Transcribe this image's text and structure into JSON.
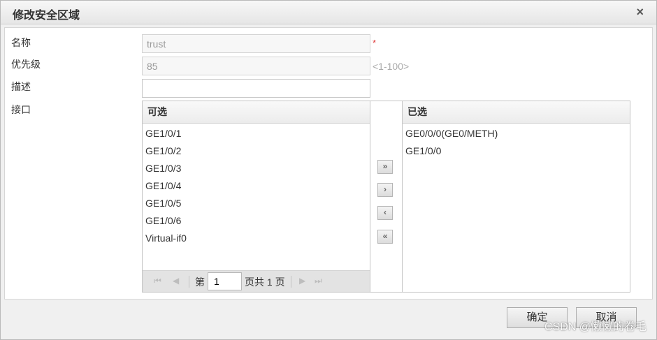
{
  "dialog": {
    "title": "修改安全区域",
    "close_glyph": "×"
  },
  "form": {
    "name_label": "名称",
    "name_value": "trust",
    "required_mark": "*",
    "priority_label": "优先级",
    "priority_value": "85",
    "priority_range": "<1-100>",
    "desc_label": "描述",
    "desc_value": "",
    "interface_label": "接口"
  },
  "available": {
    "header": "可选",
    "items": [
      "GE1/0/1",
      "GE1/0/2",
      "GE1/0/3",
      "GE1/0/4",
      "GE1/0/5",
      "GE1/0/6",
      "Virtual-if0"
    ]
  },
  "pager": {
    "first_glyph": "⏮",
    "prev_glyph": "◀",
    "next_glyph": "▶",
    "last_glyph": "⏭",
    "page_prefix": "第",
    "page_value": "1",
    "page_suffix": "页共 1 页"
  },
  "movers": {
    "add_all": "»",
    "add": "›",
    "remove": "‹",
    "remove_all": "«"
  },
  "selected": {
    "header": "已选",
    "items": [
      "GE0/0/0(GE0/METH)",
      "GE1/0/0"
    ]
  },
  "footer": {
    "ok_label": "确定",
    "cancel_label": "取消"
  },
  "watermark": "CSDN @懒懒的卷毛"
}
